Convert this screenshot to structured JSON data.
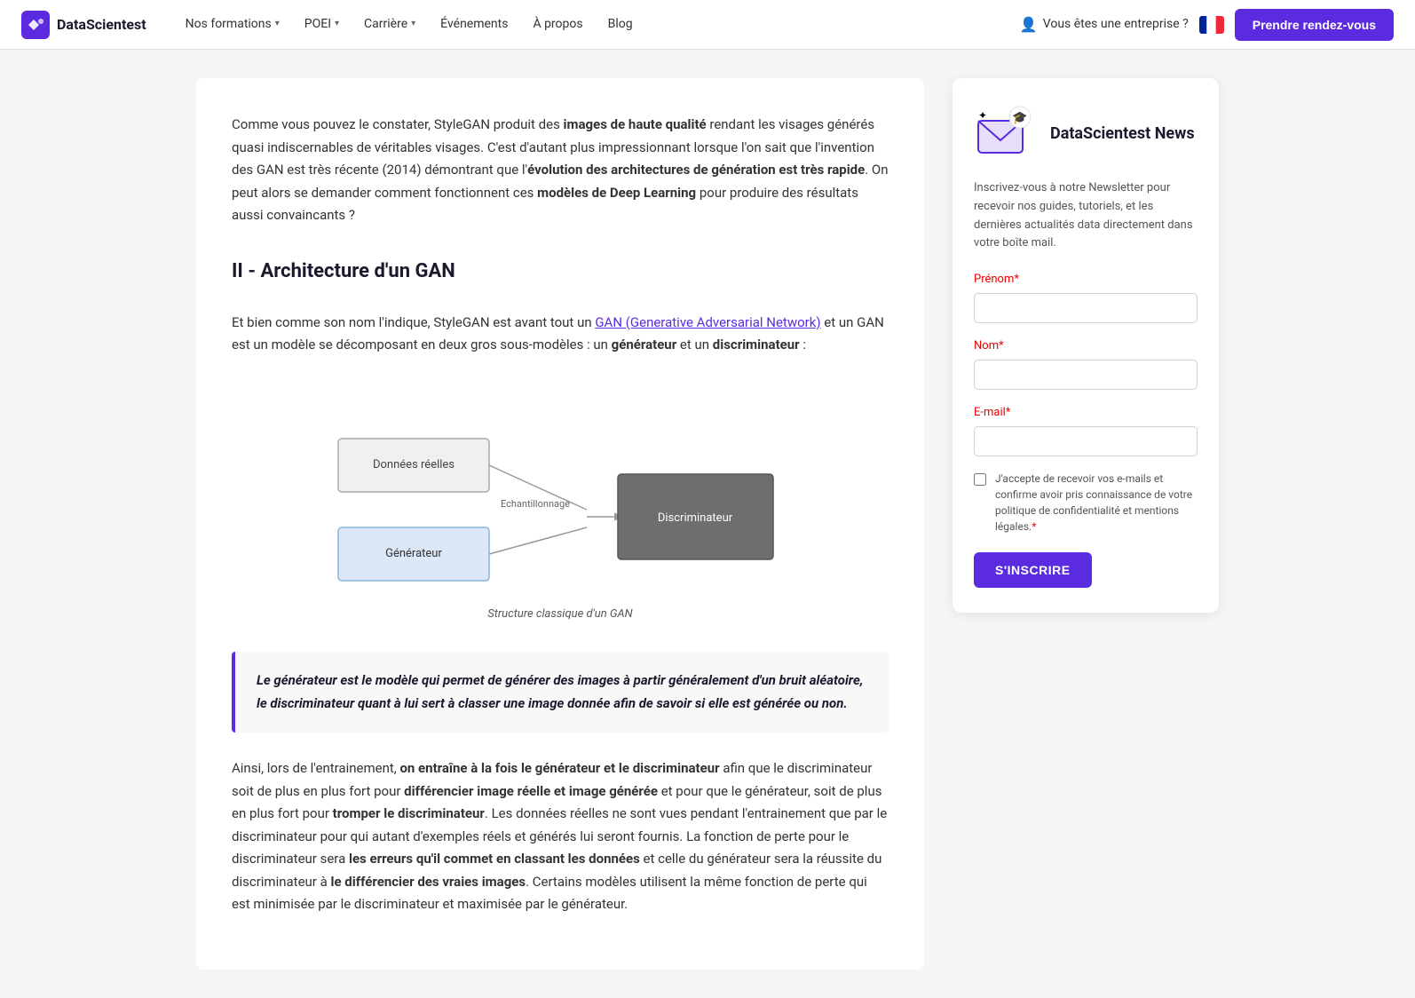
{
  "nav": {
    "logo_text": "DataScientest",
    "links": [
      {
        "id": "formations",
        "label": "Nos formations",
        "has_dropdown": true
      },
      {
        "id": "poei",
        "label": "POEI",
        "has_dropdown": true
      },
      {
        "id": "carriere",
        "label": "Carrière",
        "has_dropdown": true
      },
      {
        "id": "evenements",
        "label": "Événements",
        "has_dropdown": false
      },
      {
        "id": "apropos",
        "label": "À propos",
        "has_dropdown": false
      },
      {
        "id": "blog",
        "label": "Blog",
        "has_dropdown": false
      }
    ],
    "enterprise_label": "Vous êtes une entreprise ?",
    "cta_label": "Prendre rendez-vous"
  },
  "main": {
    "intro_text_1": "Comme vous pouvez le constater, StyleGAN produit des ",
    "intro_bold_1": "images de haute qualité",
    "intro_text_2": " rendant les visages générés quasi indiscernables de véritables visages. C'est d'autant plus impressionnant lorsque l'on sait que l'invention des GAN est très récente (2014) démontrant que l'",
    "intro_bold_2": "évolution des architectures de génération est très rapide",
    "intro_text_3": ". On peut alors se demander comment fonctionnent ces ",
    "intro_bold_3": "modèles de Deep Learning",
    "intro_text_4": " pour produire des résultats aussi convaincants ?",
    "section_heading": "II - Architecture d'un GAN",
    "section_intro_1": "Et bien comme son nom l'indique, StyleGAN est avant tout un ",
    "section_link": "GAN (Generative Adversarial Network)",
    "section_intro_2": " et un GAN est un modèle se décomposant en deux gros sous-modèles : un ",
    "section_bold_1": "générateur",
    "section_intro_3": " et un ",
    "section_bold_2": "discriminateur",
    "section_intro_4": " :",
    "diagram_caption": "Structure classique d'un GAN",
    "diagram_nodes": {
      "donnees": "Données réelles",
      "generateur": "Générateur",
      "echantillonnage": "Echantillonnage",
      "discriminateur": "Discriminateur"
    },
    "quote": "Le générateur est le modèle qui permet de générer des images à partir généralement d'un bruit aléatoire, le discriminateur quant à lui sert à classer une image donnée afin de savoir si elle est générée ou non.",
    "body_para_1_1": "Ainsi, lors de l'entrainement, ",
    "body_para_1_bold_1": "on entraîne à la fois le générateur et le discriminateur",
    "body_para_1_2": " afin que le discriminateur soit de plus en plus fort pour ",
    "body_para_1_bold_2": "différencier image réelle et image générée",
    "body_para_1_3": " et pour que le générateur, soit de plus en plus fort pour ",
    "body_para_1_bold_3": "tromper le discriminateur",
    "body_para_1_4": ". Les données réelles ne sont vues pendant l'entrainement que par le discriminateur pour qui autant d'exemples réels et générés lui seront fournis. La fonction de perte pour le discriminateur sera ",
    "body_para_1_bold_4": "les erreurs qu'il commet en classant les données",
    "body_para_1_5": " et celle du générateur sera la réussite du discriminateur à ",
    "body_para_1_bold_5": "le différencier des vraies images",
    "body_para_1_6": ". Certains modèles utilisent la même fonction de perte qui est minimisée par le discriminateur et maximisée par le générateur."
  },
  "sidebar": {
    "title": "DataScientest News",
    "description": "Inscrivez-vous à notre Newsletter pour recevoir nos guides, tutoriels, et les dernières actualités data directement dans votre boîte mail.",
    "form": {
      "prenom_label": "Prénom",
      "prenom_required": "*",
      "nom_label": "Nom",
      "nom_required": "*",
      "email_label": "E-mail",
      "email_required": "*",
      "checkbox_label": "J'accepte de recevoir vos e-mails et confirme avoir pris connaissance de votre politique de confidentialité et mentions légales.",
      "checkbox_required": "*",
      "submit_label": "S'INSCRIRE"
    }
  }
}
